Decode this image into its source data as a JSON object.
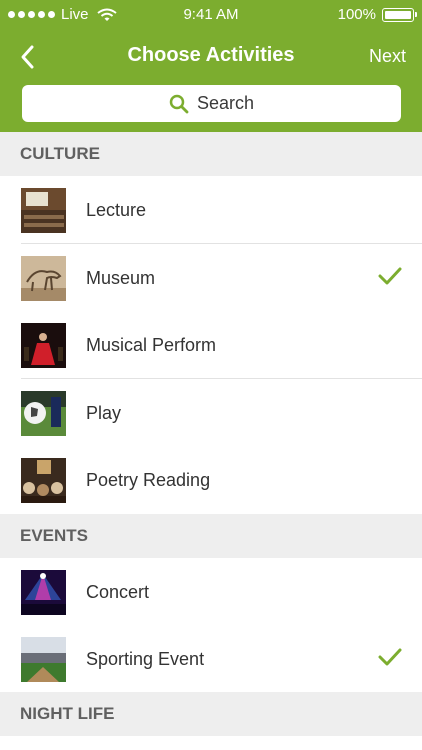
{
  "status_bar": {
    "carrier": "Live",
    "time": "9:41 AM",
    "battery": "100%"
  },
  "nav": {
    "title": "Choose Activities",
    "next_label": "Next"
  },
  "search": {
    "label": "Search"
  },
  "sections": [
    {
      "title": "CULTURE",
      "items": [
        {
          "label": "Lecture",
          "selected": false
        },
        {
          "label": "Museum",
          "selected": true
        },
        {
          "label": "Musical Perform",
          "selected": false
        },
        {
          "label": "Play",
          "selected": false
        },
        {
          "label": "Poetry Reading",
          "selected": false
        }
      ]
    },
    {
      "title": "EVENTS",
      "items": [
        {
          "label": "Concert",
          "selected": false
        },
        {
          "label": "Sporting Event",
          "selected": true
        }
      ]
    },
    {
      "title": "NIGHT LIFE",
      "items": []
    }
  ],
  "colors": {
    "accent": "#7cad2f",
    "section_bg": "#eeeeee",
    "check": "#7cad2f"
  }
}
